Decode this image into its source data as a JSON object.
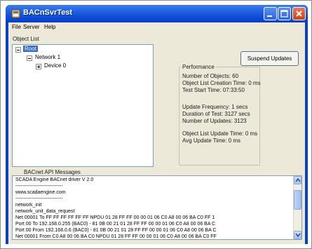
{
  "window": {
    "title": "BACnSvrTest"
  },
  "menu": {
    "file": "File",
    "server": "Server",
    "help": "Help"
  },
  "object_list": {
    "label": "Object List",
    "tree": {
      "root": "Root",
      "network": "Network 1",
      "device": "Device 0"
    }
  },
  "suspend_button": "Suspend Updates",
  "performance": {
    "title": "Performance",
    "lines": [
      "Number of Objects: 60",
      "Object List Creation Time: 0 ms",
      "Test Start Time: 07:33:50",
      "Update Frequency: 1 secs",
      "Duration of Test: 3127 secs",
      "Number of Updates: 3123",
      "Object List Update Time: 0 ms",
      "Avg Update Time: 0 ms"
    ]
  },
  "messages": {
    "label": "BACnet API Messages",
    "lines": [
      "SCADA Engine BACnet driver V 2.0",
      "-----------------------------",
      "www.scadaengine.com",
      "-----------------------------",
      "network_init",
      "network_unit_data_request",
      "Net 00001 To    FF FF FF FF FF FF NPDU 01 28 FF FF 00 00 01 06 C0 A8 00 06 BA C0 FF 1",
      "Port 00 To    192.168.0.255 (BAC0) - 81 0B 00 21 01 28 FF FF 00 00 01 06 C0 A8 00 06 BA C",
      "Port 00 From 192.168.0.6 (BAC0) - 81 0B 00 21 01 28 FF FF 00 00 01 06 C0 A8 00 06 BA C",
      "Net 00001 From  C0 A8 00 06 BA C0 NPDU 01 28 FF FF 00 00 01 06 C0 A8 00 06 BA C0 FF"
    ]
  }
}
